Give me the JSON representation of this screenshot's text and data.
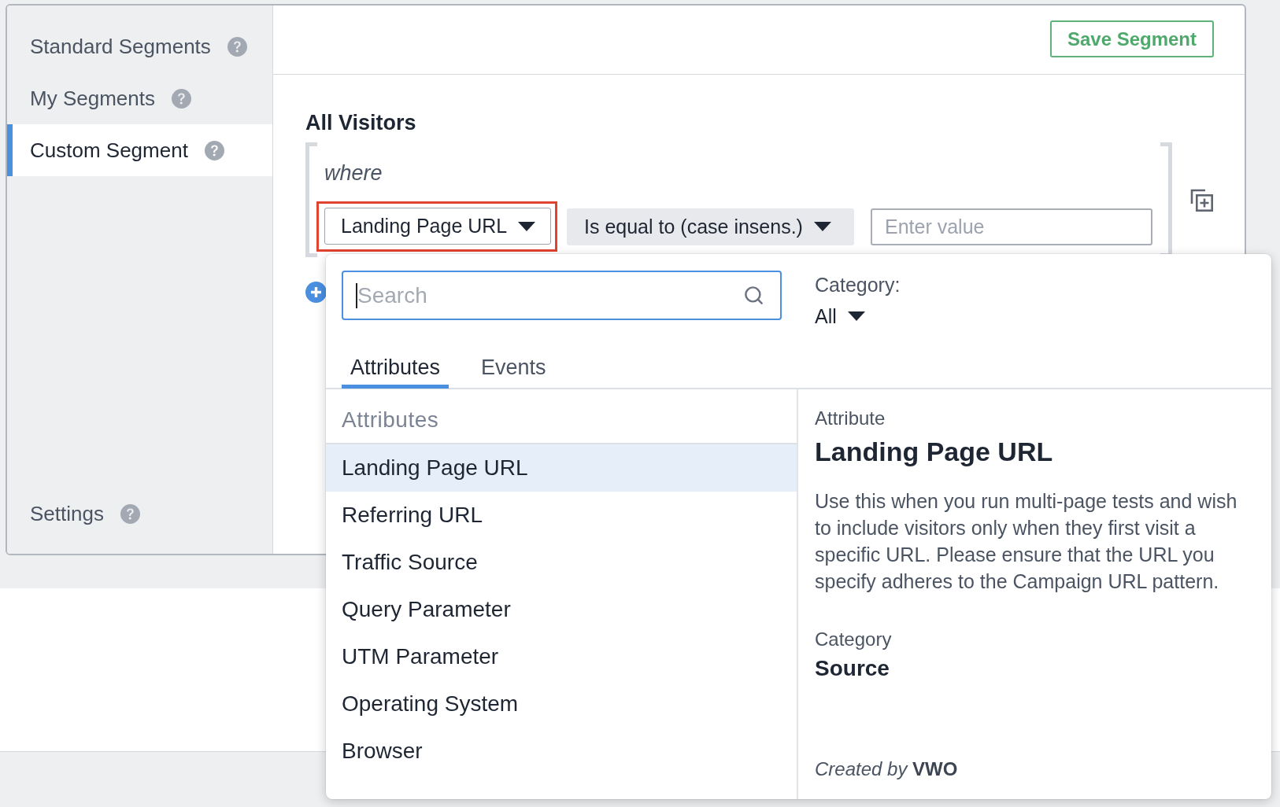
{
  "sidebar": {
    "items": [
      {
        "label": "Standard Segments",
        "selected": false
      },
      {
        "label": "My Segments",
        "selected": false
      },
      {
        "label": "Custom Segment",
        "selected": true
      }
    ],
    "settings_item": {
      "label": "Settings",
      "selected": false
    }
  },
  "header": {
    "save_button": "Save Segment"
  },
  "segment": {
    "title": "All Visitors",
    "where_label": "where",
    "condition": {
      "attribute": "Landing Page URL",
      "highlighted": true,
      "operator": "Is equal to (case insens.)",
      "value_placeholder": "Enter value"
    }
  },
  "dropdown": {
    "search": {
      "placeholder": "Search"
    },
    "category": {
      "label": "Category:",
      "value": "All"
    },
    "tabs": [
      {
        "label": "Attributes",
        "selected": true
      },
      {
        "label": "Events",
        "selected": false
      }
    ],
    "group_title": "Attributes",
    "items": [
      {
        "label": "Landing Page URL",
        "selected": true
      },
      {
        "label": "Referring URL",
        "selected": false
      },
      {
        "label": "Traffic Source",
        "selected": false
      },
      {
        "label": "Query Parameter",
        "selected": false
      },
      {
        "label": "UTM Parameter",
        "selected": false
      },
      {
        "label": "Operating System",
        "selected": false
      },
      {
        "label": "Browser",
        "selected": false
      }
    ],
    "detail": {
      "type_label": "Attribute",
      "title": "Landing Page URL",
      "description": "Use this when you run multi-page tests and wish to include visitors only when they first visit a specific URL. Please ensure that the URL you specify adheres to the Campaign URL pattern.",
      "category_label": "Category",
      "category_value": "Source",
      "credit": "*Created by* **VWO**"
    }
  }
}
